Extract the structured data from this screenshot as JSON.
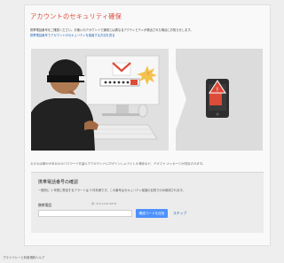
{
  "page": {
    "title": "アカウントのセキュリティ確保",
    "intro": "携帯電話番号をご確認ください。お使いのアカウントで通常とは異なるアクティビティが検出された場合にお知らせします。",
    "intro_link": "携帯電話番号でアカウントのセキュリティを保護する方法を見る",
    "caption": "ただえば誰かがあなたのパスワードを盗んでアカウントにログインしようとした場合など、テキスト メッセージが送信されます。"
  },
  "illustration": {
    "mail_logo": "M"
  },
  "verify": {
    "title": "携帯電話番号の確認",
    "description": "一般的に 1 年間に受信するアラートは 3 件未満です。この番号はセキュリティ保護の目的でのみ使用されます。",
    "phone_label": "携帯電話",
    "phone_hint": "例: 070-1234-5678",
    "phone_value": "",
    "send_label": "確認コードを送信",
    "skip_label": "スキップ"
  },
  "footer": {
    "privacy": "プライバシーと利用規約",
    "help": "ヘルプ"
  },
  "colors": {
    "title_red": "#dd4b39",
    "link_blue": "#1a5fb4",
    "button_blue": "#4d90fe"
  }
}
